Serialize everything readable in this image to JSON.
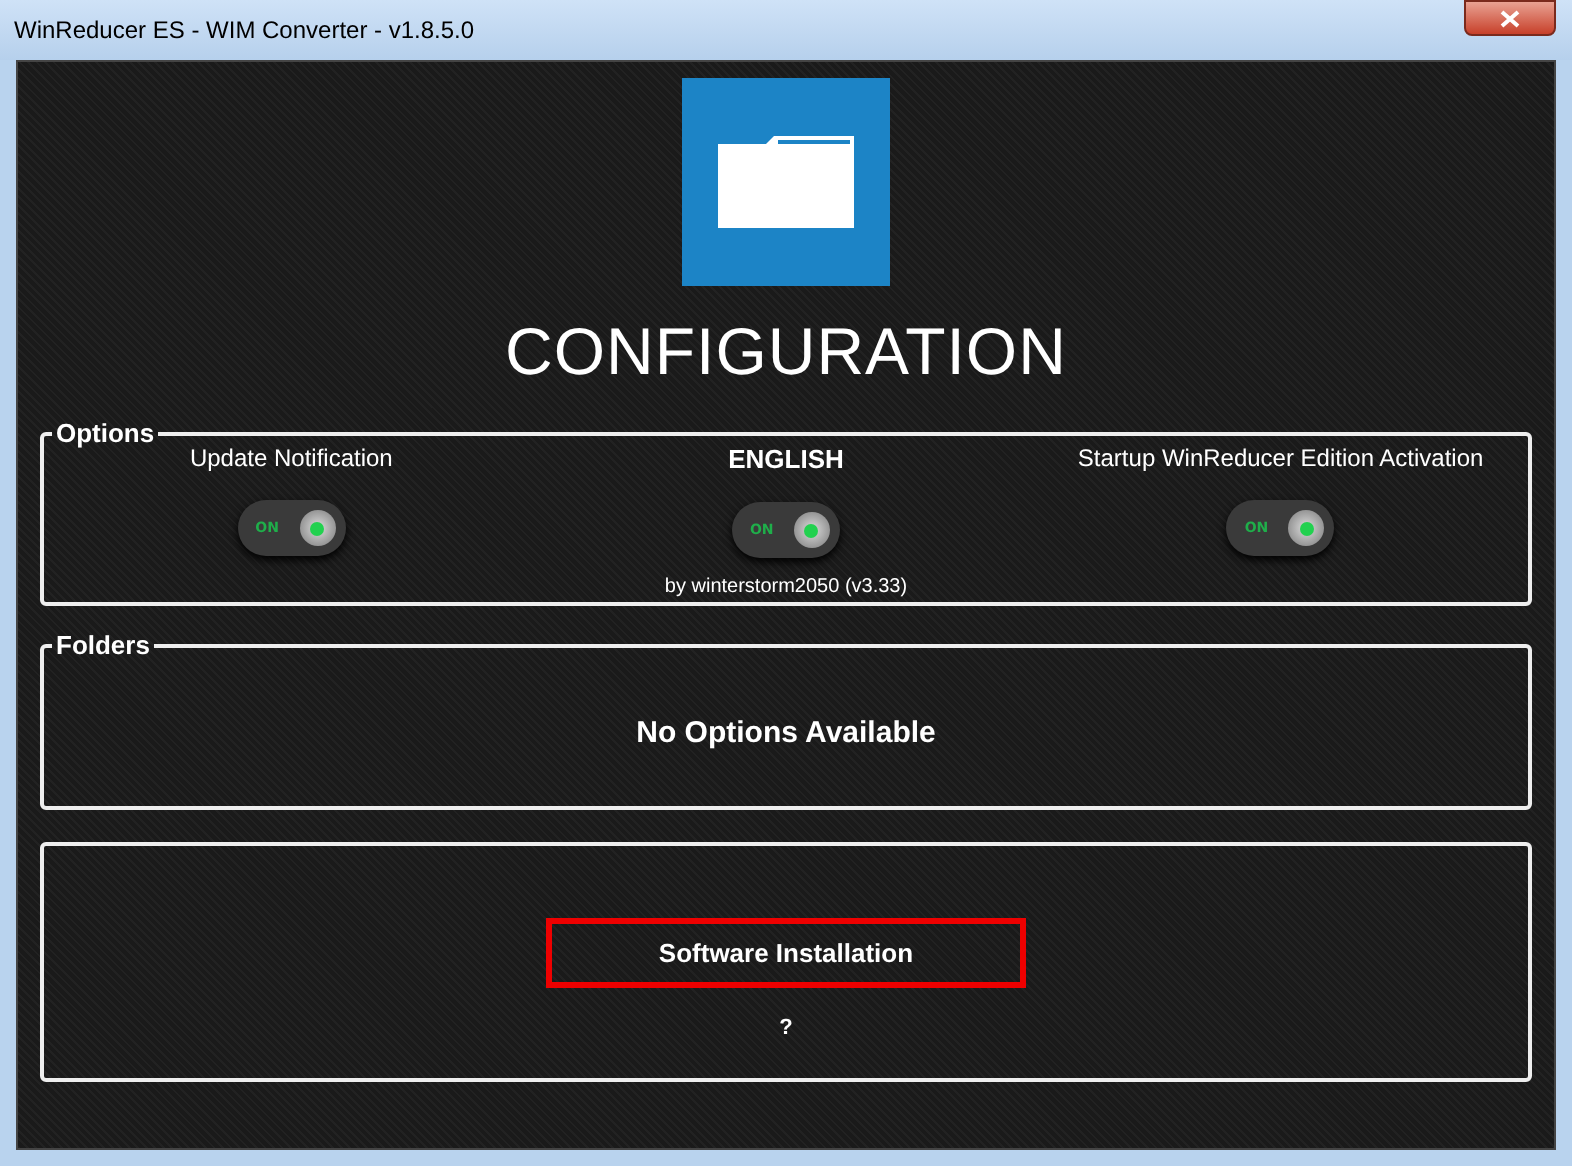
{
  "window": {
    "title": "WinReducer ES - WIM Converter - v1.8.5.0"
  },
  "heading": "CONFIGURATION",
  "options": {
    "legend": "Options",
    "toggles": [
      {
        "label": "Update Notification",
        "bold": false,
        "on": true,
        "state_text": "ON"
      },
      {
        "label": "ENGLISH",
        "bold": true,
        "on": true,
        "state_text": "ON",
        "caption": "by winterstorm2050 (v3.33)"
      },
      {
        "label": "Startup WinReducer Edition Activation",
        "bold": false,
        "on": true,
        "state_text": "ON"
      }
    ]
  },
  "folders": {
    "legend": "Folders",
    "message": "No Options Available"
  },
  "install": {
    "button": "Software Installation",
    "help": "?"
  }
}
